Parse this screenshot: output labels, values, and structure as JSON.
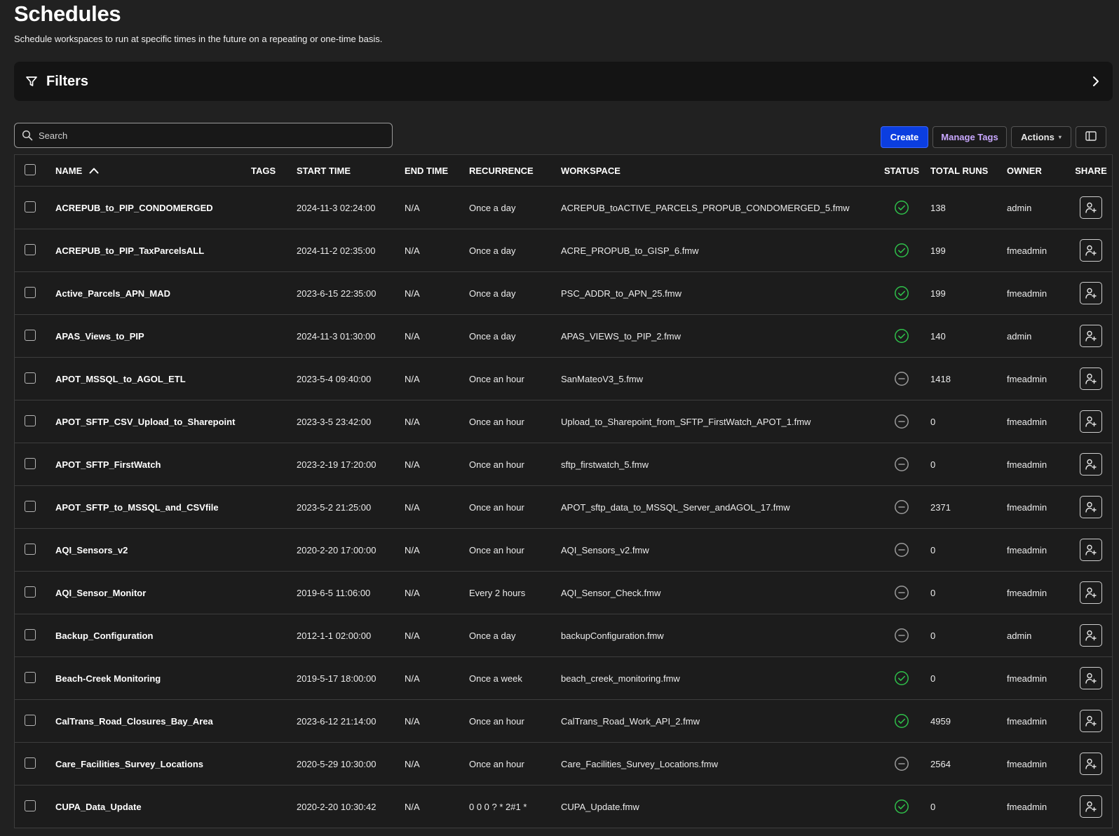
{
  "header": {
    "title": "Schedules",
    "subtitle": "Schedule workspaces to run at specific times in the future on a repeating or one-time basis."
  },
  "filters": {
    "label": "Filters"
  },
  "search": {
    "placeholder": "Search"
  },
  "toolbar": {
    "create_label": "Create",
    "manage_tags_label": "Manage Tags",
    "actions_label": "Actions"
  },
  "table": {
    "columns": {
      "name": "NAME",
      "tags": "TAGS",
      "start_time": "START TIME",
      "end_time": "END TIME",
      "recurrence": "RECURRENCE",
      "workspace": "WORKSPACE",
      "status": "STATUS",
      "total_runs": "TOTAL RUNS",
      "owner": "OWNER",
      "share": "SHARE"
    },
    "sort": {
      "column": "name",
      "direction": "ascending"
    },
    "rows": [
      {
        "name": "ACREPUB_to_PIP_CONDOMERGED",
        "tags": "",
        "start": "2024-11-3 02:24:00",
        "end": "N/A",
        "recurrence": "Once a day",
        "workspace": "ACREPUB_toACTIVE_PARCELS_PROPUB_CONDOMERGED_5.fmw",
        "status": "enabled",
        "runs": "138",
        "owner": "admin"
      },
      {
        "name": "ACREPUB_to_PIP_TaxParcelsALL",
        "tags": "",
        "start": "2024-11-2 02:35:00",
        "end": "N/A",
        "recurrence": "Once a day",
        "workspace": "ACRE_PROPUB_to_GISP_6.fmw",
        "status": "enabled",
        "runs": "199",
        "owner": "fmeadmin"
      },
      {
        "name": "Active_Parcels_APN_MAD",
        "tags": "",
        "start": "2023-6-15 22:35:00",
        "end": "N/A",
        "recurrence": "Once a day",
        "workspace": "PSC_ADDR_to_APN_25.fmw",
        "status": "enabled",
        "runs": "199",
        "owner": "fmeadmin"
      },
      {
        "name": "APAS_Views_to_PIP",
        "tags": "",
        "start": "2024-11-3 01:30:00",
        "end": "N/A",
        "recurrence": "Once a day",
        "workspace": "APAS_VIEWS_to_PIP_2.fmw",
        "status": "enabled",
        "runs": "140",
        "owner": "admin"
      },
      {
        "name": "APOT_MSSQL_to_AGOL_ETL",
        "tags": "",
        "start": "2023-5-4 09:40:00",
        "end": "N/A",
        "recurrence": "Once an hour",
        "workspace": "SanMateoV3_5.fmw",
        "status": "disabled",
        "runs": "1418",
        "owner": "fmeadmin"
      },
      {
        "name": "APOT_SFTP_CSV_Upload_to_Sharepoint",
        "tags": "",
        "start": "2023-3-5 23:42:00",
        "end": "N/A",
        "recurrence": "Once an hour",
        "workspace": "Upload_to_Sharepoint_from_SFTP_FirstWatch_APOT_1.fmw",
        "status": "disabled",
        "runs": "0",
        "owner": "fmeadmin"
      },
      {
        "name": "APOT_SFTP_FirstWatch",
        "tags": "",
        "start": "2023-2-19 17:20:00",
        "end": "N/A",
        "recurrence": "Once an hour",
        "workspace": "sftp_firstwatch_5.fmw",
        "status": "disabled",
        "runs": "0",
        "owner": "fmeadmin"
      },
      {
        "name": "APOT_SFTP_to_MSSQL_and_CSVfile",
        "tags": "",
        "start": "2023-5-2 21:25:00",
        "end": "N/A",
        "recurrence": "Once an hour",
        "workspace": "APOT_sftp_data_to_MSSQL_Server_andAGOL_17.fmw",
        "status": "disabled",
        "runs": "2371",
        "owner": "fmeadmin"
      },
      {
        "name": "AQI_Sensors_v2",
        "tags": "",
        "start": "2020-2-20 17:00:00",
        "end": "N/A",
        "recurrence": "Once an hour",
        "workspace": "AQI_Sensors_v2.fmw",
        "status": "disabled",
        "runs": "0",
        "owner": "fmeadmin"
      },
      {
        "name": "AQI_Sensor_Monitor",
        "tags": "",
        "start": "2019-6-5 11:06:00",
        "end": "N/A",
        "recurrence": "Every 2 hours",
        "workspace": "AQI_Sensor_Check.fmw",
        "status": "disabled",
        "runs": "0",
        "owner": "fmeadmin"
      },
      {
        "name": "Backup_Configuration",
        "tags": "",
        "start": "2012-1-1 02:00:00",
        "end": "N/A",
        "recurrence": "Once a day",
        "workspace": "backupConfiguration.fmw",
        "status": "disabled",
        "runs": "0",
        "owner": "admin"
      },
      {
        "name": "Beach-Creek Monitoring",
        "tags": "",
        "start": "2019-5-17 18:00:00",
        "end": "N/A",
        "recurrence": "Once a week",
        "workspace": "beach_creek_monitoring.fmw",
        "status": "enabled",
        "runs": "0",
        "owner": "fmeadmin"
      },
      {
        "name": "CalTrans_Road_Closures_Bay_Area",
        "tags": "",
        "start": "2023-6-12 21:14:00",
        "end": "N/A",
        "recurrence": "Once an hour",
        "workspace": "CalTrans_Road_Work_API_2.fmw",
        "status": "enabled",
        "runs": "4959",
        "owner": "fmeadmin"
      },
      {
        "name": "Care_Facilities_Survey_Locations",
        "tags": "",
        "start": "2020-5-29 10:30:00",
        "end": "N/A",
        "recurrence": "Once an hour",
        "workspace": "Care_Facilities_Survey_Locations.fmw",
        "status": "disabled",
        "runs": "2564",
        "owner": "fmeadmin"
      },
      {
        "name": "CUPA_Data_Update",
        "tags": "",
        "start": "2020-2-20 10:30:42",
        "end": "N/A",
        "recurrence": "0 0 0 ? * 2#1 *",
        "workspace": "CUPA_Update.fmw",
        "status": "enabled",
        "runs": "0",
        "owner": "fmeadmin"
      }
    ]
  },
  "icons": {
    "filter": "filter-funnel-icon",
    "filters_toggle": "chevron-right-icon",
    "search": "search-icon",
    "sort": "sort-ascending-icon",
    "column_settings": "column-layout-icon",
    "status_enabled": "check-circle-icon",
    "status_disabled": "minus-circle-icon",
    "share": "share-user-add-icon"
  },
  "colors": {
    "background": "#212121",
    "panel": "#141414",
    "primary_button": "#0b3ee0",
    "manage_tags_text": "#c9a8ff",
    "status_enabled": "#2fbf4a",
    "status_disabled": "#9a9a9a"
  }
}
